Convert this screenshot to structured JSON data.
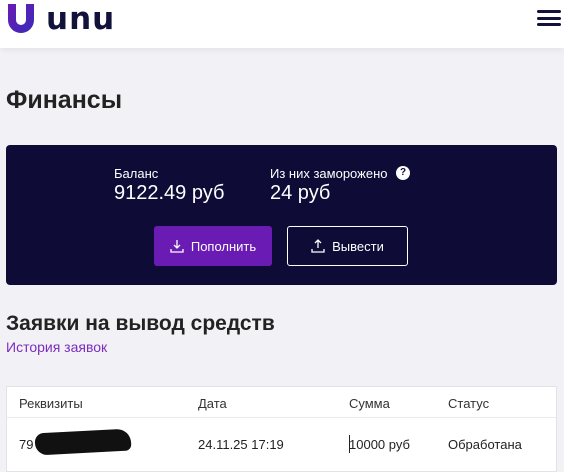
{
  "header": {
    "brand": "unu",
    "brand_color": "#6a1bb3",
    "menu_icon": "hamburger-menu-icon"
  },
  "page": {
    "title": "Финансы"
  },
  "balance": {
    "balance_label": "Баланс",
    "balance_value": "9122.49 руб",
    "frozen_label": "Из них заморожено",
    "frozen_value": "24 руб",
    "help_icon": "question-circle-icon",
    "deposit_label": "Пополнить",
    "deposit_icon": "download-icon",
    "withdraw_label": "Вывести",
    "withdraw_icon": "upload-icon"
  },
  "withdrawals": {
    "title": "Заявки на вывод средств",
    "history_link": "История заявок",
    "columns": [
      "Реквизиты",
      "Дата",
      "Сумма",
      "Статус"
    ],
    "rows": [
      {
        "details": "79",
        "date": "24.11.25 17:19",
        "amount": "10000 руб",
        "status": "Обработана"
      }
    ]
  }
}
